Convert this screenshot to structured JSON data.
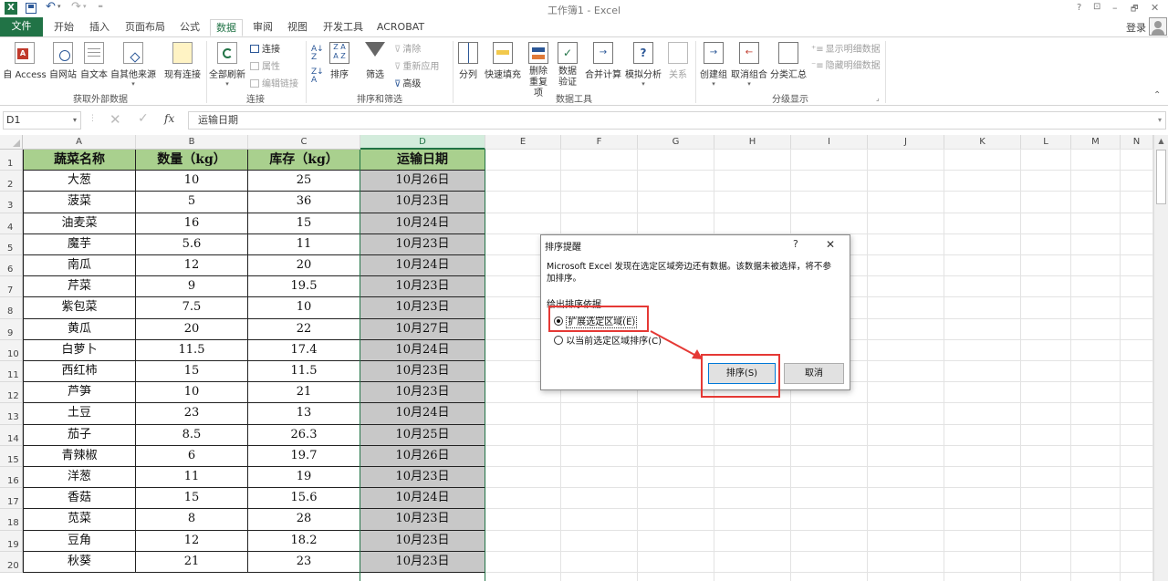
{
  "window": {
    "title": "工作簿1 - Excel",
    "controls": [
      "?",
      "⊡",
      "–",
      "🗗",
      "✕"
    ],
    "signin": "登录"
  },
  "tabs": [
    "文件",
    "开始",
    "插入",
    "页面布局",
    "公式",
    "数据",
    "审阅",
    "视图",
    "开发工具",
    "ACROBAT"
  ],
  "active_tab": "数据",
  "ribbon": {
    "get_external": {
      "buttons": [
        "自 Access",
        "自网站",
        "自文本",
        "自其他来源",
        "现有连接"
      ],
      "label": "获取外部数据"
    },
    "connections": {
      "refresh": "全部刷新",
      "items": [
        "连接",
        "属性",
        "编辑链接"
      ],
      "label": "连接"
    },
    "sort_filter": {
      "sort": "排序",
      "filter": "筛选",
      "items": [
        "清除",
        "重新应用",
        "高级"
      ],
      "label": "排序和筛选"
    },
    "data_tools": {
      "buttons": [
        "分列",
        "快速填充",
        "删除重复项",
        "数据验证",
        "合并计算",
        "模拟分析",
        "关系"
      ],
      "label": "数据工具"
    },
    "outline": {
      "buttons": [
        "创建组",
        "取消组合",
        "分类汇总"
      ],
      "items": [
        "显示明细数据",
        "隐藏明细数据"
      ],
      "label": "分级显示"
    }
  },
  "formula_bar": {
    "name_box": "D1",
    "fx": "fx",
    "content": "运输日期"
  },
  "columns": [
    "A",
    "B",
    "C",
    "D",
    "E",
    "F",
    "G",
    "H",
    "I",
    "J",
    "K",
    "L",
    "M",
    "N"
  ],
  "selected_column": "D",
  "headers": [
    "蔬菜名称",
    "数量（kg）",
    "库存（kg）",
    "运输日期"
  ],
  "rows": [
    [
      "大葱",
      "10",
      "25",
      "10月26日"
    ],
    [
      "菠菜",
      "5",
      "36",
      "10月23日"
    ],
    [
      "油麦菜",
      "16",
      "15",
      "10月24日"
    ],
    [
      "魔芋",
      "5.6",
      "11",
      "10月23日"
    ],
    [
      "南瓜",
      "12",
      "20",
      "10月24日"
    ],
    [
      "芹菜",
      "9",
      "19.5",
      "10月23日"
    ],
    [
      "紫包菜",
      "7.5",
      "10",
      "10月23日"
    ],
    [
      "黄瓜",
      "20",
      "22",
      "10月27日"
    ],
    [
      "白萝卜",
      "11.5",
      "17.4",
      "10月24日"
    ],
    [
      "西红柿",
      "15",
      "11.5",
      "10月23日"
    ],
    [
      "芦笋",
      "10",
      "21",
      "10月23日"
    ],
    [
      "土豆",
      "23",
      "13",
      "10月24日"
    ],
    [
      "茄子",
      "8.5",
      "26.3",
      "10月25日"
    ],
    [
      "青辣椒",
      "6",
      "19.7",
      "10月26日"
    ],
    [
      "洋葱",
      "11",
      "19",
      "10月23日"
    ],
    [
      "香菇",
      "15",
      "15.6",
      "10月24日"
    ],
    [
      "苋菜",
      "8",
      "28",
      "10月23日"
    ],
    [
      "豆角",
      "12",
      "18.2",
      "10月23日"
    ],
    [
      "秋葵",
      "21",
      "23",
      "10月23日"
    ]
  ],
  "dialog": {
    "title": "排序提醒",
    "help": "?",
    "close": "✕",
    "message_line1": "Microsoft Excel 发现在选定区域旁边还有数据。该数据未被选择，将不参",
    "message_line2": "加排序。",
    "group_label": "给出排序依据",
    "options": [
      "扩展选定区域(E)",
      "以当前选定区域排序(C)"
    ],
    "selected_option": 0,
    "ok": "排序(S)",
    "cancel": "取消"
  }
}
